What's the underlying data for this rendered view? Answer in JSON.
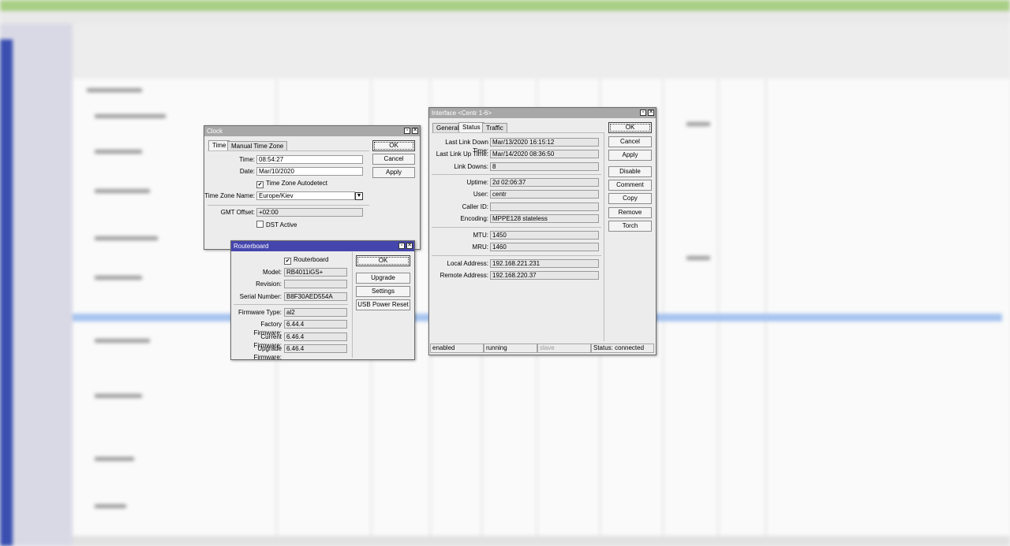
{
  "clock": {
    "title": "Clock",
    "tabs": [
      "Time",
      "Manual Time Zone"
    ],
    "fields": {
      "time_label": "Time:",
      "time": "08:54:27",
      "date_label": "Date:",
      "date": "Mar/10/2020",
      "autodetect_label": "Time Zone Autodetect",
      "tz_label": "Time Zone Name:",
      "tz": "Europe/Kiev",
      "gmt_label": "GMT Offset:",
      "gmt": "+02:00",
      "dst_label": "DST Active"
    },
    "buttons": {
      "ok": "OK",
      "cancel": "Cancel",
      "apply": "Apply"
    }
  },
  "routerboard": {
    "title": "Routerboard",
    "checkbox_label": "Routerboard",
    "fields": {
      "model_label": "Model:",
      "model": "RB4011iGS+",
      "revision_label": "Revision:",
      "revision": "",
      "serial_label": "Serial Number:",
      "serial": "B8F30AED554A",
      "fwtype_label": "Firmware Type:",
      "fwtype": "al2",
      "factory_label": "Factory Firmware:",
      "factory": "6.44.4",
      "current_label": "Current Firmware:",
      "current": "6.46.4",
      "upgrade_label": "Upgrade Firmware:",
      "upgrade": "6.46.4"
    },
    "buttons": {
      "ok": "OK",
      "upgrade": "Upgrade",
      "settings": "Settings",
      "usb": "USB Power Reset"
    }
  },
  "interface": {
    "title": "Interface <Centr 1-6>",
    "tabs": [
      "General",
      "Status",
      "Traffic"
    ],
    "fields": {
      "ldown_label": "Last Link Down Time:",
      "ldown": "Mar/13/2020 16:15:12",
      "lup_label": "Last Link Up Time:",
      "lup": "Mar/14/2020 08:36:50",
      "downs_label": "Link Downs:",
      "downs": "8",
      "uptime_label": "Uptime:",
      "uptime": "2d 02:06:37",
      "user_label": "User:",
      "user": "centr",
      "caller_label": "Caller ID:",
      "caller": "",
      "enc_label": "Encoding:",
      "enc": "MPPE128 stateless",
      "mtu_label": "MTU:",
      "mtu": "1450",
      "mru_label": "MRU:",
      "mru": "1460",
      "local_label": "Local Address:",
      "local": "192.168.221.231",
      "remote_label": "Remote Address:",
      "remote": "192.168.220.37"
    },
    "buttons": {
      "ok": "OK",
      "cancel": "Cancel",
      "apply": "Apply",
      "disable": "Disable",
      "comment": "Comment",
      "copy": "Copy",
      "remove": "Remove",
      "torch": "Torch"
    },
    "status": {
      "enabled": "enabled",
      "running": "running",
      "slave": "slave",
      "conn": "Status: connected"
    }
  },
  "colors": {
    "title_active": "#4545ae",
    "title_inactive": "#a8a8a8",
    "app_titlebar": "#a9cf86"
  }
}
